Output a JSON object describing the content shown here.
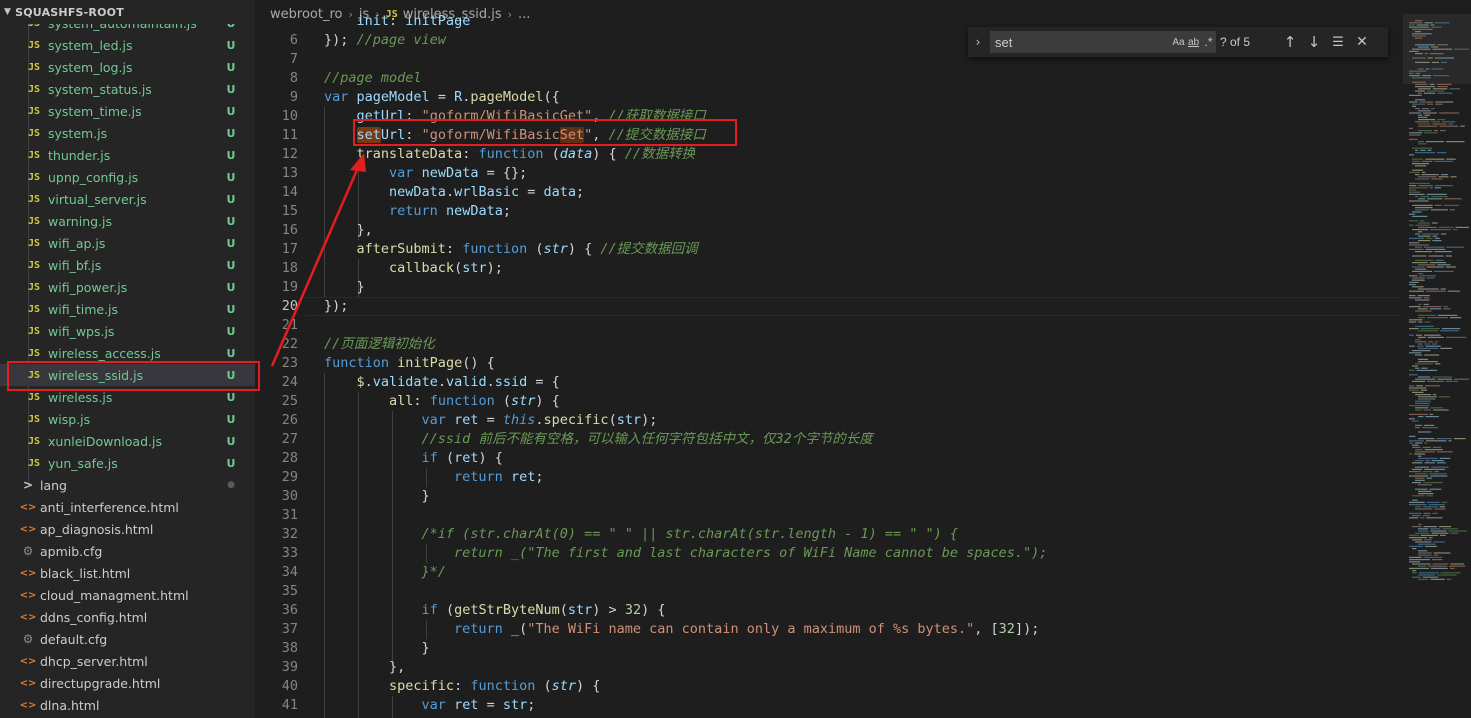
{
  "sidebar": {
    "title": "SQUASHFS-ROOT",
    "items": [
      {
        "kind": "js",
        "label": "system_automaintain.js",
        "status": "U"
      },
      {
        "kind": "js",
        "label": "system_led.js",
        "status": "U"
      },
      {
        "kind": "js",
        "label": "system_log.js",
        "status": "U"
      },
      {
        "kind": "js",
        "label": "system_status.js",
        "status": "U"
      },
      {
        "kind": "js",
        "label": "system_time.js",
        "status": "U"
      },
      {
        "kind": "js",
        "label": "system.js",
        "status": "U"
      },
      {
        "kind": "js",
        "label": "thunder.js",
        "status": "U"
      },
      {
        "kind": "js",
        "label": "upnp_config.js",
        "status": "U"
      },
      {
        "kind": "js",
        "label": "virtual_server.js",
        "status": "U"
      },
      {
        "kind": "js",
        "label": "warning.js",
        "status": "U"
      },
      {
        "kind": "js",
        "label": "wifi_ap.js",
        "status": "U"
      },
      {
        "kind": "js",
        "label": "wifi_bf.js",
        "status": "U"
      },
      {
        "kind": "js",
        "label": "wifi_power.js",
        "status": "U"
      },
      {
        "kind": "js",
        "label": "wifi_time.js",
        "status": "U"
      },
      {
        "kind": "js",
        "label": "wifi_wps.js",
        "status": "U"
      },
      {
        "kind": "js",
        "label": "wireless_access.js",
        "status": "U"
      },
      {
        "kind": "js",
        "label": "wireless_ssid.js",
        "status": "U",
        "selected": true
      },
      {
        "kind": "js",
        "label": "wireless.js",
        "status": "U"
      },
      {
        "kind": "js",
        "label": "wisp.js",
        "status": "U"
      },
      {
        "kind": "js",
        "label": "xunleiDownload.js",
        "status": "U"
      },
      {
        "kind": "js",
        "label": "yun_safe.js",
        "status": "U"
      },
      {
        "kind": "folder",
        "label": "lang",
        "status": "●"
      },
      {
        "kind": "html",
        "label": "anti_interference.html",
        "status": ""
      },
      {
        "kind": "html",
        "label": "ap_diagnosis.html",
        "status": ""
      },
      {
        "kind": "cfg",
        "label": "apmib.cfg",
        "status": ""
      },
      {
        "kind": "html",
        "label": "black_list.html",
        "status": ""
      },
      {
        "kind": "html",
        "label": "cloud_managment.html",
        "status": ""
      },
      {
        "kind": "html",
        "label": "ddns_config.html",
        "status": ""
      },
      {
        "kind": "cfg",
        "label": "default.cfg",
        "status": ""
      },
      {
        "kind": "html",
        "label": "dhcp_server.html",
        "status": ""
      },
      {
        "kind": "html",
        "label": "directupgrade.html",
        "status": ""
      },
      {
        "kind": "html",
        "label": "dlna.html",
        "status": ""
      }
    ]
  },
  "breadcrumb": {
    "root": "webroot_ro",
    "folder": "js",
    "file_icon": "JS",
    "file": "wireless_ssid.js",
    "more": "..."
  },
  "find": {
    "value": "set",
    "match_case": "Aa",
    "whole_word": "ab",
    "regex": ".*",
    "count": "? of 5"
  },
  "editor": {
    "first_line_number": 6,
    "current_line": 20,
    "lines": [
      "6",
      "7",
      "8",
      "9",
      "10",
      "11",
      "12",
      "13",
      "14",
      "15",
      "16",
      "17",
      "18",
      "19",
      "20",
      "21",
      "22",
      "23",
      "24",
      "25",
      "26",
      "27",
      "28",
      "29",
      "30",
      "31",
      "32",
      "33",
      "34",
      "35",
      "36",
      "37",
      "38",
      "39",
      "40",
      "41"
    ]
  },
  "icons": {
    "js": "JS",
    "html": "<>",
    "cfg": "⚙",
    "folder": ">"
  },
  "colors": {
    "annotation": "#e31e1e",
    "untracked": "#73c991",
    "keyword": "#569cd6",
    "string": "#ce9178",
    "comment": "#6a9955"
  }
}
